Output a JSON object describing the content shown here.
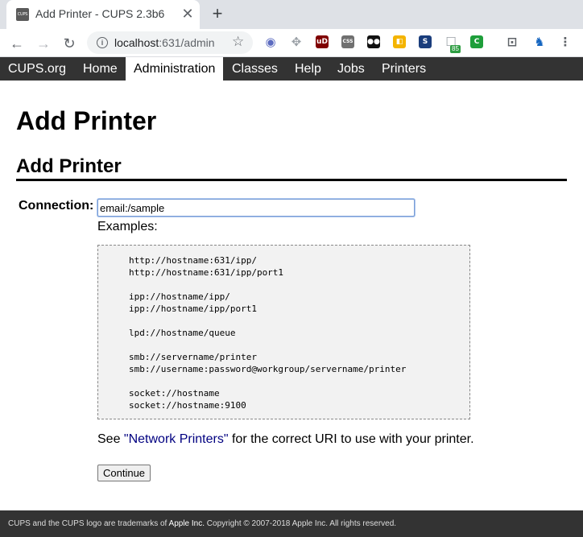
{
  "browser": {
    "tab": {
      "favicon_text": "CUPS",
      "title": "Add Printer - CUPS 2.3b6",
      "close_glyph": "✕"
    },
    "new_tab_glyph": "+",
    "nav": {
      "back": "←",
      "forward": "→",
      "reload": "↻"
    },
    "omnibox": {
      "host": "localhost",
      "path": ":631/admin",
      "info_glyph": "i",
      "star_glyph": "☆"
    },
    "extensions": [
      {
        "name": "globe-extension-icon",
        "glyph": "◉",
        "color": "#5c6bc0"
      },
      {
        "name": "move-extension-icon",
        "glyph": "✥",
        "color": "#9aa0a6"
      },
      {
        "name": "ublock-extension-icon",
        "glyph": "uD",
        "color": "#800000"
      },
      {
        "name": "css-extension-icon",
        "glyph": "CSS",
        "color": "#707070"
      },
      {
        "name": "tabs-extension-icon",
        "glyph": "●●",
        "color": "#111111"
      },
      {
        "name": "color-extension-icon",
        "glyph": "◧",
        "color": "#f4b400"
      },
      {
        "name": "s-extension-icon",
        "glyph": "S",
        "color": "#1a3d7c"
      },
      {
        "name": "counter-extension-icon",
        "glyph": "☐",
        "color": "#9aa0a6",
        "badge": "85"
      },
      {
        "name": "green-extension-icon",
        "glyph": "C",
        "color": "#1e9e3a"
      },
      {
        "name": "cast-icon",
        "glyph": "⊡",
        "color": "#5f6368"
      },
      {
        "name": "profile-extension-icon",
        "glyph": "♞",
        "color": "#1565c0"
      },
      {
        "name": "menu-icon",
        "glyph": "⋮",
        "color": "#5f6368"
      }
    ]
  },
  "cups_nav": {
    "items": [
      {
        "label": "CUPS.org"
      },
      {
        "label": "Home"
      },
      {
        "label": "Administration",
        "active": true
      },
      {
        "label": "Classes"
      },
      {
        "label": "Help"
      },
      {
        "label": "Jobs"
      },
      {
        "label": "Printers"
      }
    ]
  },
  "page": {
    "title": "Add Printer",
    "section_title": "Add Printer",
    "connection_label": "Connection:",
    "connection_value": "email:/sample",
    "examples_label": "Examples:",
    "examples": "http://hostname:631/ipp/\nhttp://hostname:631/ipp/port1\n\nipp://hostname/ipp/\nipp://hostname/ipp/port1\n\nlpd://hostname/queue\n\nsmb://servername/printer\nsmb://username:password@workgroup/servername/printer\n\nsocket://hostname\nsocket://hostname:9100",
    "see_prefix": "See ",
    "see_link": "\"Network Printers\"",
    "see_suffix": " for the correct URI to use with your printer.",
    "continue_label": "Continue"
  },
  "footer": {
    "prefix": "CUPS and the CUPS logo are trademarks of ",
    "apple": "Apple Inc.",
    "suffix": " Copyright © 2007-2018 Apple Inc. All rights reserved."
  }
}
